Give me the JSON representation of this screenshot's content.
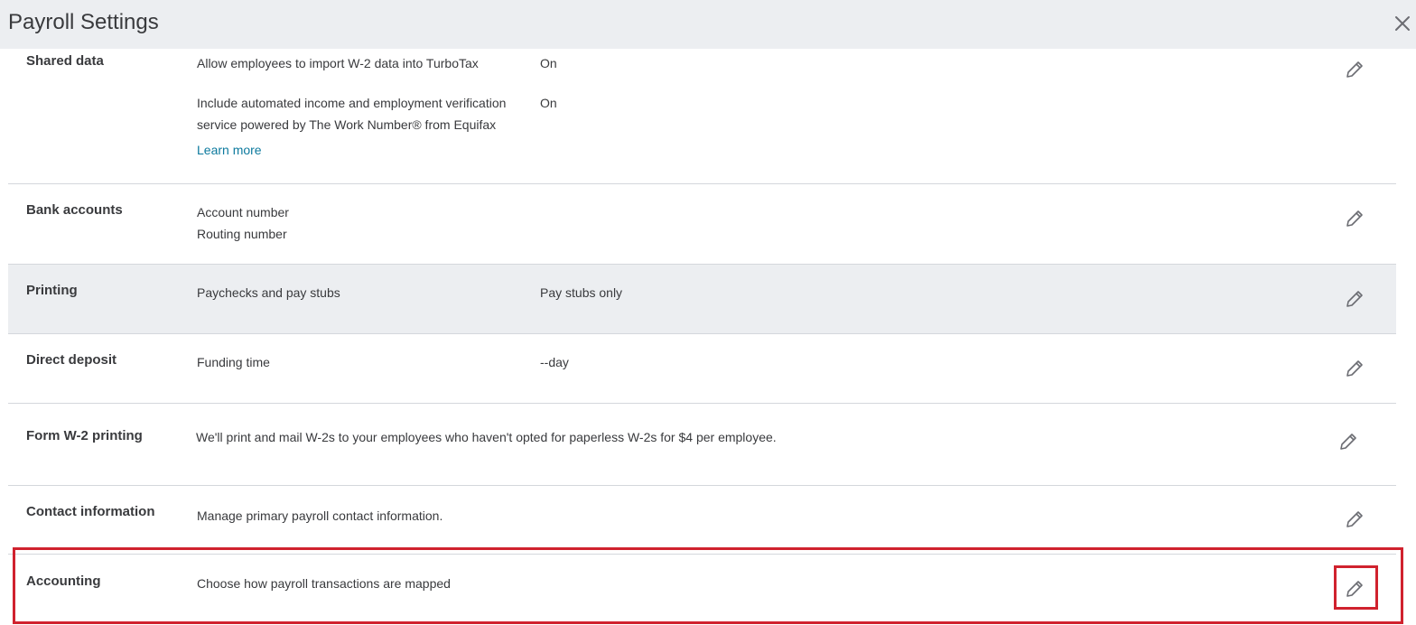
{
  "header": {
    "title": "Payroll Settings",
    "close_icon": "close-icon"
  },
  "sections": {
    "shared_data": {
      "title": "Shared data",
      "rows": [
        {
          "label_lines": [
            "Allow employees to import W-2 data into TurboTax"
          ],
          "value": "On"
        },
        {
          "label_lines": [
            "Include automated income and employment verification",
            "service powered by The Work Number® from Equifax"
          ],
          "value": "On"
        }
      ],
      "link": "Learn more",
      "edit_icon": "pencil-icon"
    },
    "bank_accounts": {
      "title": "Bank accounts",
      "lines": [
        "Account number",
        "Routing number"
      ],
      "edit_icon": "pencil-icon"
    },
    "printing": {
      "title": "Printing",
      "label": "Paychecks and pay stubs",
      "value": "Pay stubs only",
      "edit_icon": "pencil-icon"
    },
    "direct_deposit": {
      "title": "Direct deposit",
      "label": "Funding time",
      "value": "--day",
      "edit_icon": "pencil-icon"
    },
    "form_w2": {
      "title": "Form W-2 printing",
      "text": "We'll print and mail W-2s to your employees who haven't opted for paperless W-2s for $4 per employee.",
      "edit_icon": "pencil-icon"
    },
    "contact": {
      "title": "Contact information",
      "text": "Manage primary payroll contact information.",
      "edit_icon": "pencil-icon"
    },
    "accounting": {
      "title": "Accounting",
      "text": "Choose how payroll transactions are mapped",
      "edit_icon": "pencil-icon"
    }
  },
  "colors": {
    "header_bg": "#eceef1",
    "shaded_row_bg": "#eceef1",
    "divider": "#d4d7dc",
    "link": "#0d7a9e",
    "highlight": "#d0222e",
    "text": "#393a3d"
  }
}
